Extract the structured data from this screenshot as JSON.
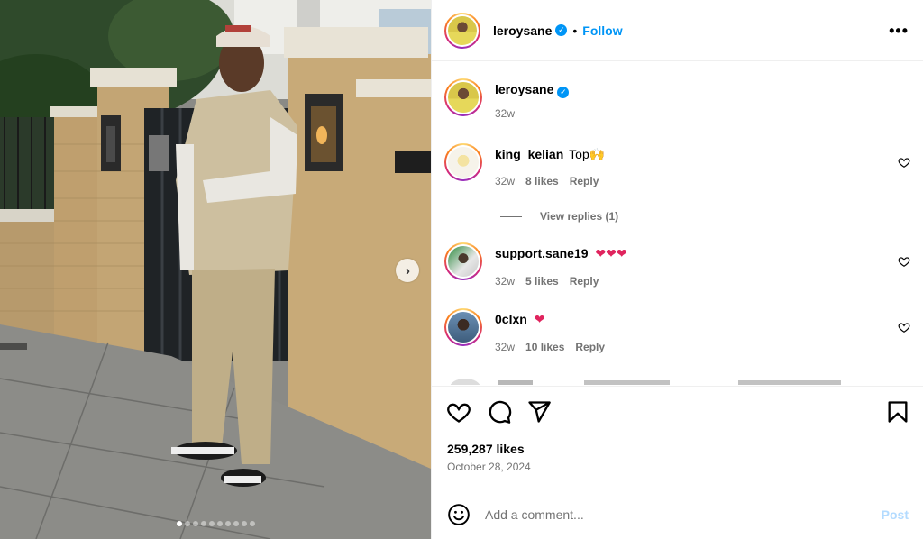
{
  "post": {
    "author": "leroysane",
    "follow_label": "Follow",
    "separator": "•",
    "more_label": "•••",
    "caption": "__",
    "caption_time": "32w",
    "likes": "259,287 likes",
    "date": "October 28, 2024",
    "carousel": {
      "slides": 10,
      "active_index": 0
    }
  },
  "comments": [
    {
      "user": "king_kelian",
      "text": "Top🙌",
      "time": "32w",
      "likes": "8 likes",
      "reply_label": "Reply"
    },
    {
      "user": "support.sane19",
      "text": "❤❤❤",
      "time": "32w",
      "likes": "5 likes",
      "reply_label": "Reply"
    },
    {
      "user": "0clxn",
      "text": "❤",
      "time": "32w",
      "likes": "10 likes",
      "reply_label": "Reply"
    }
  ],
  "view_replies": "View replies (1)",
  "composer": {
    "placeholder": "Add a comment...",
    "post_label": "Post"
  },
  "colors": {
    "accent": "#0095f6",
    "muted": "#737373",
    "post_disabled": "#b3dbff",
    "heart_red": "#e0245e"
  },
  "icons": {
    "header": [
      "verified-badge-icon",
      "more-options-icon"
    ],
    "actions": [
      "heart-icon",
      "comment-icon",
      "share-icon",
      "save-icon"
    ],
    "composer": [
      "emoji-icon"
    ],
    "photo": [
      "chevron-right-icon"
    ]
  }
}
